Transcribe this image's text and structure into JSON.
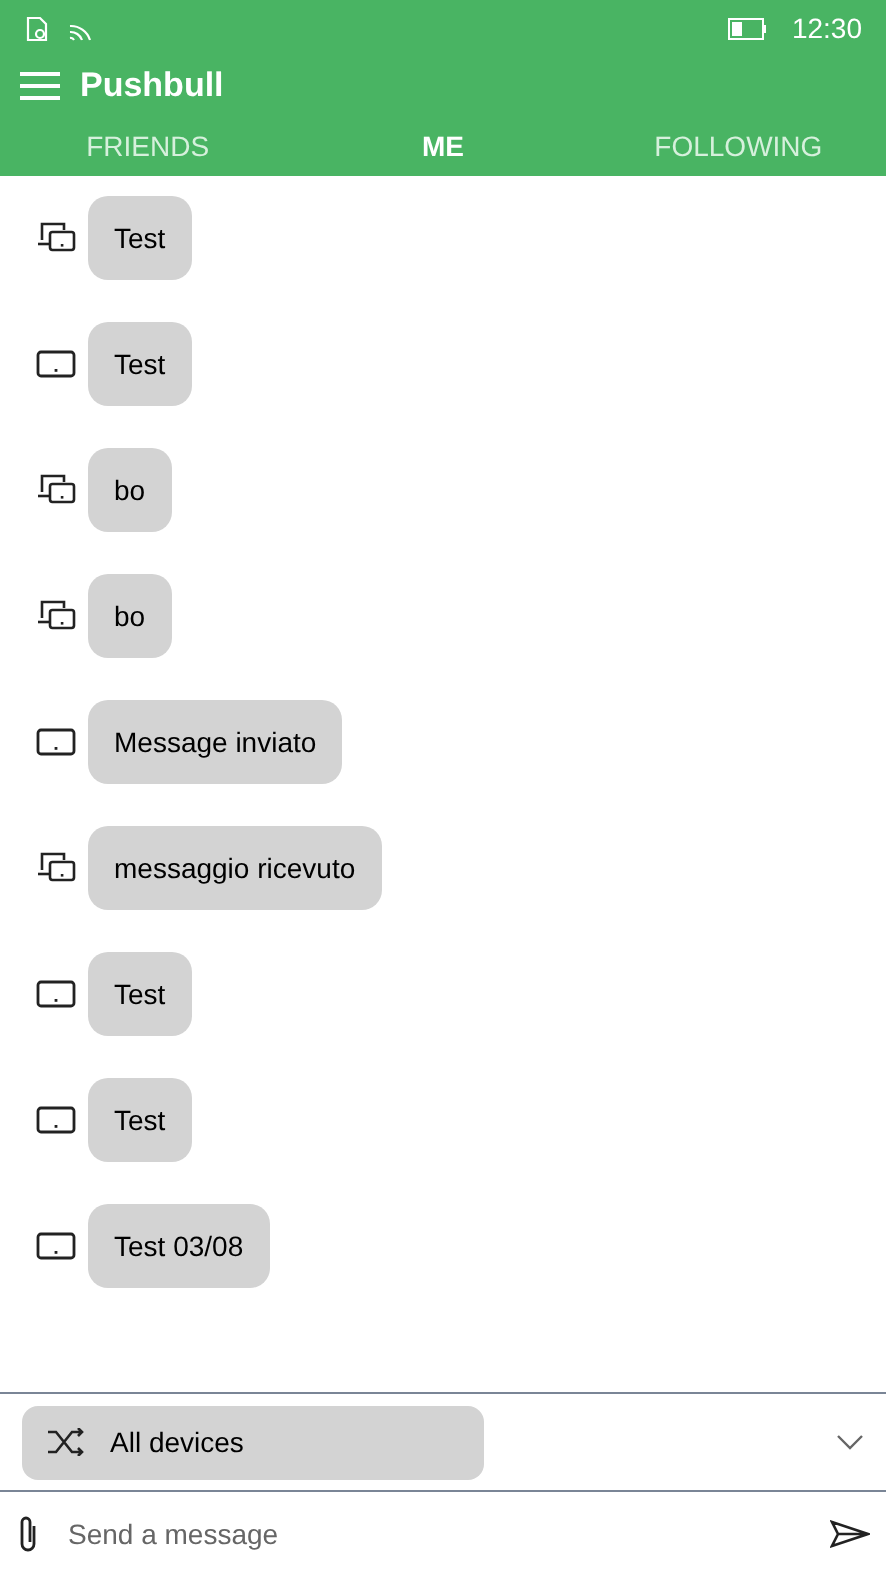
{
  "status_bar": {
    "time": "12:30"
  },
  "app_bar": {
    "title": "Pushbull"
  },
  "tabs": [
    {
      "label": "FRIENDS",
      "selected": false
    },
    {
      "label": "ME",
      "selected": true
    },
    {
      "label": "FOLLOWING",
      "selected": false
    }
  ],
  "messages": [
    {
      "kind": "multi",
      "text": "Test"
    },
    {
      "kind": "single",
      "text": "Test"
    },
    {
      "kind": "multi",
      "text": "bo"
    },
    {
      "kind": "multi",
      "text": "bo"
    },
    {
      "kind": "single",
      "text": "Message inviato"
    },
    {
      "kind": "multi",
      "text": "messaggio ricevuto"
    },
    {
      "kind": "single",
      "text": "Test"
    },
    {
      "kind": "single",
      "text": "Test"
    },
    {
      "kind": "single",
      "text": "Test 03/08"
    }
  ],
  "device_picker": {
    "value": "All devices"
  },
  "composer": {
    "placeholder": "Send a message"
  }
}
